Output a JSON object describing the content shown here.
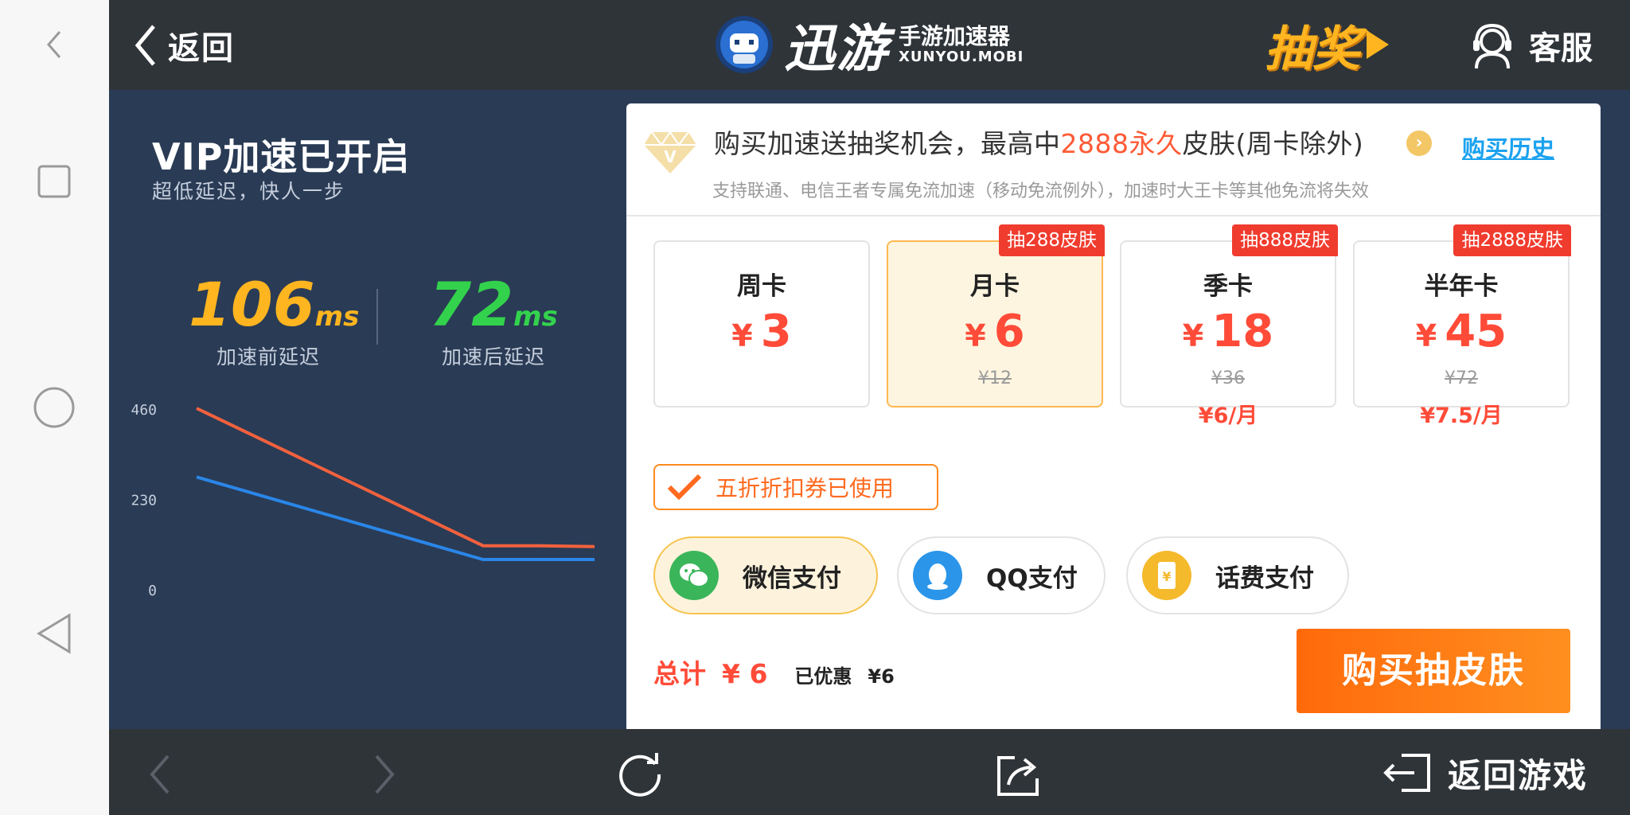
{
  "topbar": {
    "back_label": "返回",
    "logo_name": "迅游",
    "logo_sub": "手游加速器",
    "logo_domain": "XUNYOU.MOBI",
    "lottery_label": "抽奖",
    "service_label": "客服"
  },
  "left": {
    "title": "VIP加速已开启",
    "subtitle": "超低延迟，快人一步",
    "before": {
      "value": "106",
      "unit": "ms",
      "caption": "加速前延迟"
    },
    "after": {
      "value": "72",
      "unit": "ms",
      "caption": "加速后延迟"
    }
  },
  "chart_data": {
    "type": "line",
    "x": [
      0,
      1,
      2,
      3
    ],
    "ylim": [
      0,
      460
    ],
    "yticks": [
      "460",
      "230",
      "0"
    ],
    "series": [
      {
        "color": "#f2613d",
        "values": [
          460,
          110,
          110,
          108
        ]
      },
      {
        "color": "#2a86e8",
        "values": [
          285,
          75,
          75,
          75
        ]
      }
    ],
    "grid": false
  },
  "right": {
    "promo_prefix": "购买加速送抽奖机会，最高中",
    "promo_highlight": "2888永久",
    "promo_suffix": "皮肤(周卡除外)",
    "history_label": "购买历史",
    "notice": "支持联通、电信王者专属免流加速（移动免流例外），加速时大王卡等其他免流将失效",
    "plans": [
      {
        "name": "周卡",
        "price": "3",
        "original": "",
        "per_month": "",
        "tag": ""
      },
      {
        "name": "月卡",
        "price": "6",
        "original": "¥12",
        "per_month": "",
        "tag": "抽288皮肤"
      },
      {
        "name": "季卡",
        "price": "18",
        "original": "¥36",
        "per_month": "¥6/月",
        "tag": "抽888皮肤"
      },
      {
        "name": "半年卡",
        "price": "45",
        "original": "¥72",
        "per_month": "¥7.5/月",
        "tag": "抽2888皮肤"
      }
    ],
    "currency": "¥",
    "coupon_label": "五折折扣券已使用",
    "payments": [
      {
        "label": "微信支付",
        "color": "#3bb55a"
      },
      {
        "label": "QQ支付",
        "color": "#2b95e9"
      },
      {
        "label": "话费支付",
        "color": "#f5b92c"
      }
    ],
    "total_label": "总计",
    "total_value": "¥ 6",
    "discount_label": "已优惠",
    "discount_value": "¥6",
    "buy_label": "购买抽皮肤"
  },
  "bottombar": {
    "return_label": "返回游戏"
  },
  "colors": {
    "accent_orange": "#ff6a0b",
    "price_red": "#ff4b38",
    "dark_bar": "#2f3439",
    "panel_blue": "#2a3b55"
  }
}
